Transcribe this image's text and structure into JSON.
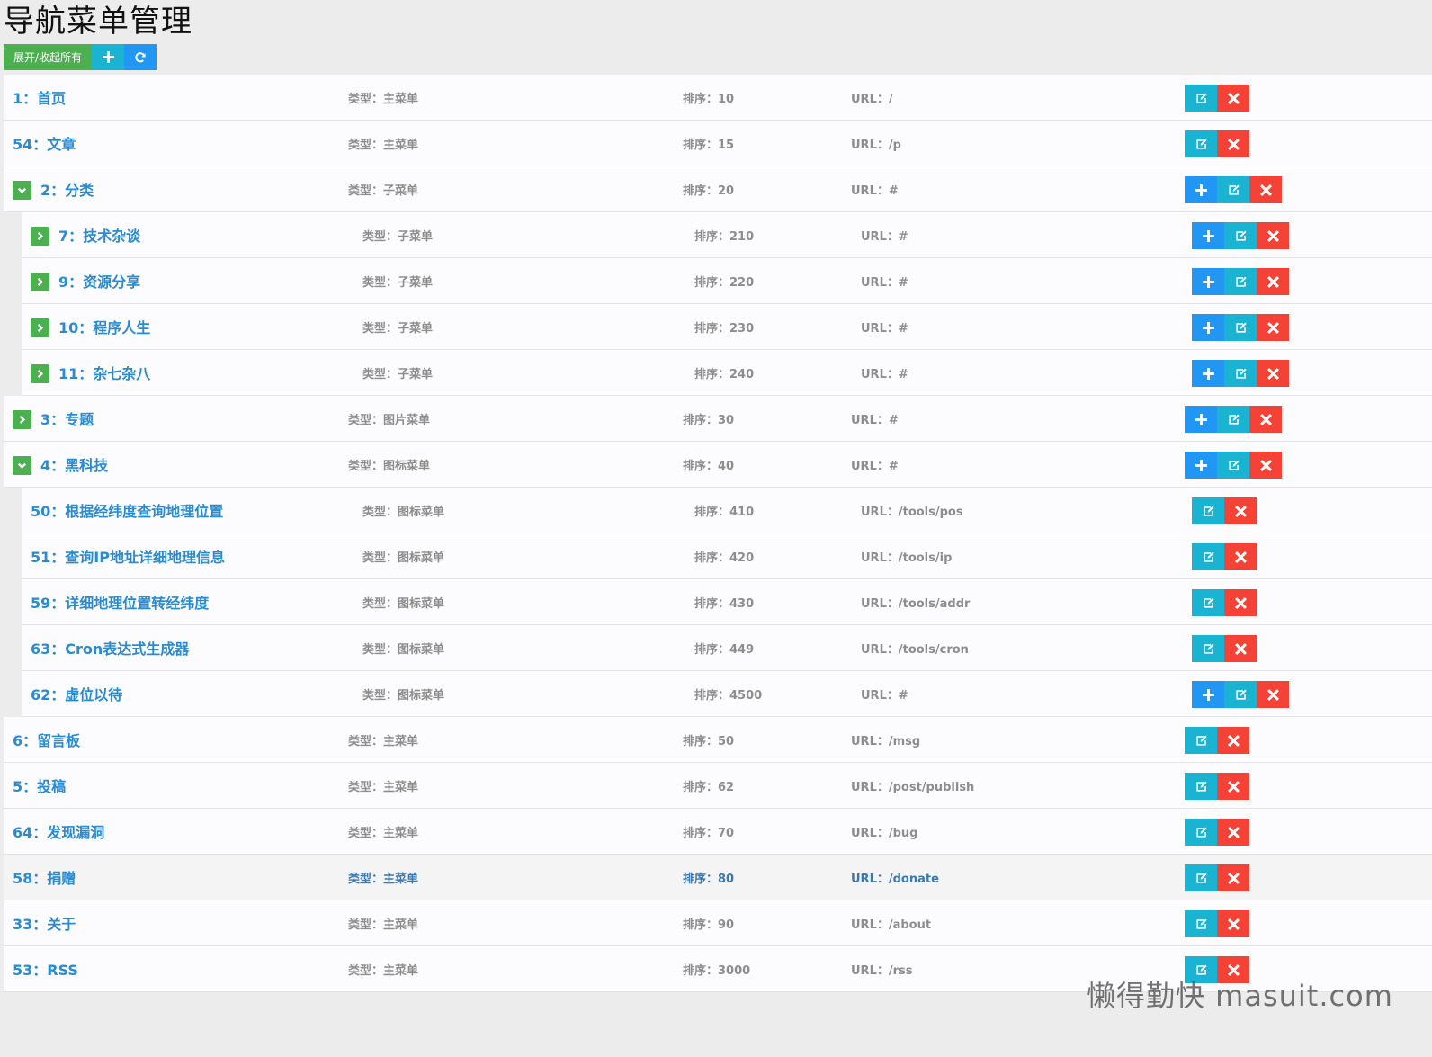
{
  "page": {
    "title": "导航菜单管理"
  },
  "toolbar": {
    "expand_label": "展开/收起所有",
    "add_icon": "plus-icon",
    "refresh_icon": "refresh-icon"
  },
  "labels": {
    "type_prefix": "类型：",
    "sort_prefix": "排序：",
    "url_prefix": "URL："
  },
  "colors": {
    "green": "#4caf50",
    "cyan": "#1ab4d2",
    "blue": "#2196f3",
    "red": "#f44336",
    "link": "#2a8bd0"
  },
  "menus": [
    {
      "name": "1：首页",
      "type": "主菜单",
      "sort": "10",
      "url": "/",
      "level": 0,
      "toggle": null,
      "add": false
    },
    {
      "name": "54：文章",
      "type": "主菜单",
      "sort": "15",
      "url": "/p",
      "level": 0,
      "toggle": null,
      "add": false
    },
    {
      "name": "2：分类",
      "type": "子菜单",
      "sort": "20",
      "url": "#",
      "level": 0,
      "toggle": "expanded",
      "add": true
    },
    {
      "name": "7：技术杂谈",
      "type": "子菜单",
      "sort": "210",
      "url": "#",
      "level": 1,
      "toggle": "collapsed",
      "add": true
    },
    {
      "name": "9：资源分享",
      "type": "子菜单",
      "sort": "220",
      "url": "#",
      "level": 1,
      "toggle": "collapsed",
      "add": true
    },
    {
      "name": "10：程序人生",
      "type": "子菜单",
      "sort": "230",
      "url": "#",
      "level": 1,
      "toggle": "collapsed",
      "add": true
    },
    {
      "name": "11：杂七杂八",
      "type": "子菜单",
      "sort": "240",
      "url": "#",
      "level": 1,
      "toggle": "collapsed",
      "add": true
    },
    {
      "name": "3：专题",
      "type": "图片菜单",
      "sort": "30",
      "url": "#",
      "level": 0,
      "toggle": "collapsed",
      "add": true
    },
    {
      "name": "4：黑科技",
      "type": "图标菜单",
      "sort": "40",
      "url": "#",
      "level": 0,
      "toggle": "expanded",
      "add": true
    },
    {
      "name": "50：根据经纬度查询地理位置",
      "type": "图标菜单",
      "sort": "410",
      "url": "/tools/pos",
      "level": 1,
      "toggle": null,
      "add": false
    },
    {
      "name": "51：查询IP地址详细地理信息",
      "type": "图标菜单",
      "sort": "420",
      "url": "/tools/ip",
      "level": 1,
      "toggle": null,
      "add": false
    },
    {
      "name": "59：详细地理位置转经纬度",
      "type": "图标菜单",
      "sort": "430",
      "url": "/tools/addr",
      "level": 1,
      "toggle": null,
      "add": false
    },
    {
      "name": "63：Cron表达式生成器",
      "type": "图标菜单",
      "sort": "449",
      "url": "/tools/cron",
      "level": 1,
      "toggle": null,
      "add": false
    },
    {
      "name": "62：虚位以待",
      "type": "图标菜单",
      "sort": "4500",
      "url": "#",
      "level": 1,
      "toggle": null,
      "add": true
    },
    {
      "name": "6：留言板",
      "type": "主菜单",
      "sort": "50",
      "url": "/msg",
      "level": 0,
      "toggle": null,
      "add": false
    },
    {
      "name": "5：投稿",
      "type": "主菜单",
      "sort": "62",
      "url": "/post/publish",
      "level": 0,
      "toggle": null,
      "add": false
    },
    {
      "name": "64：发现漏洞",
      "type": "主菜单",
      "sort": "70",
      "url": "/bug",
      "level": 0,
      "toggle": null,
      "add": false
    },
    {
      "name": "58：捐赠",
      "type": "主菜单",
      "sort": "80",
      "url": "/donate",
      "level": 0,
      "toggle": null,
      "add": false,
      "highlighted": true
    },
    {
      "name": "33：关于",
      "type": "主菜单",
      "sort": "90",
      "url": "/about",
      "level": 0,
      "toggle": null,
      "add": false
    },
    {
      "name": "53：RSS",
      "type": "主菜单",
      "sort": "3000",
      "url": "/rss",
      "level": 0,
      "toggle": null,
      "add": false
    }
  ],
  "watermark": "懒得勤快 masuit.com"
}
